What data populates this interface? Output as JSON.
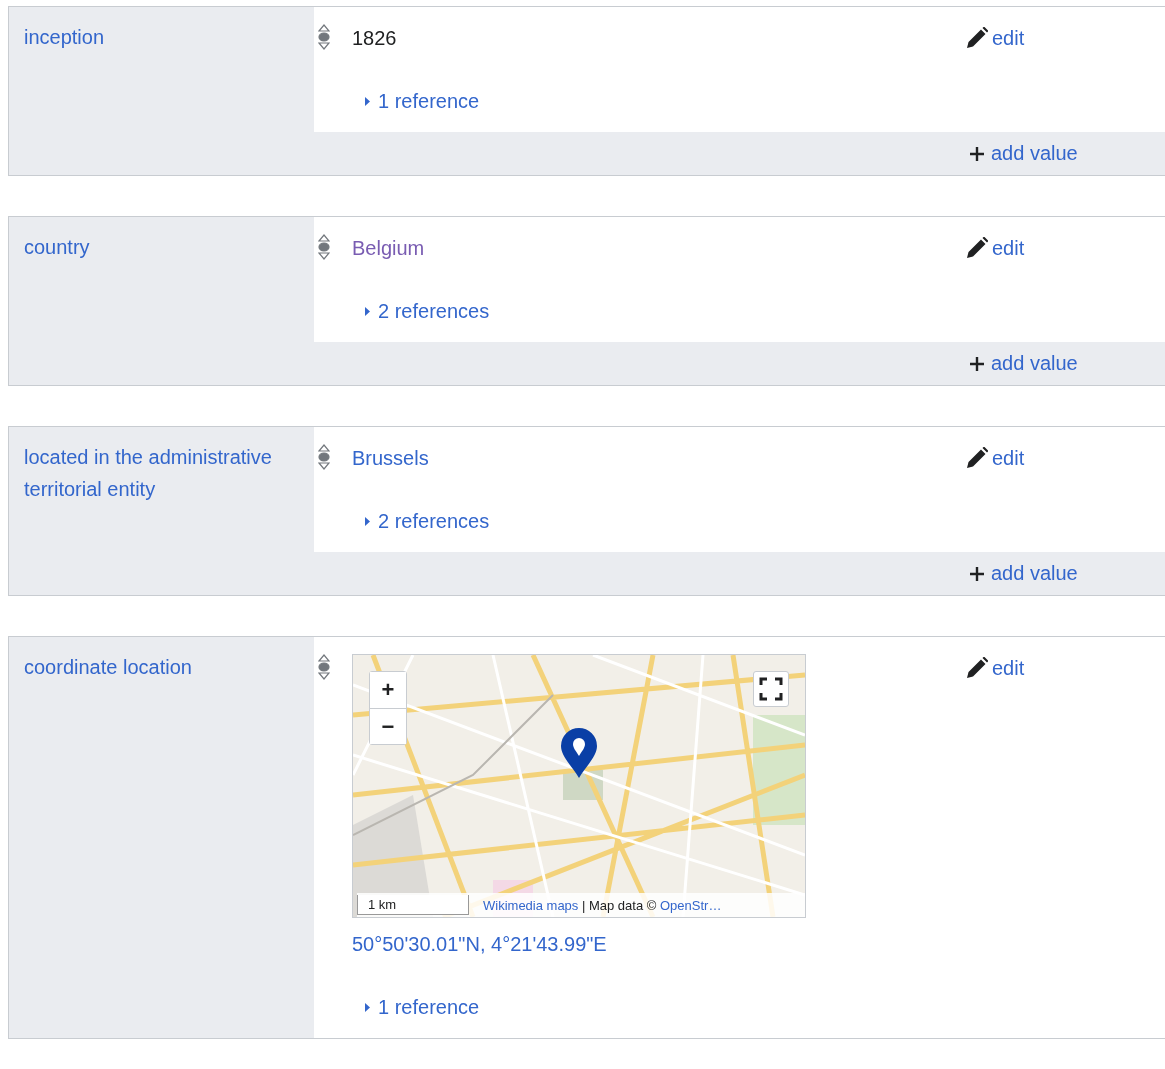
{
  "statements": [
    {
      "property": "inception",
      "values": [
        {
          "kind": "text",
          "preferred": false,
          "deprecated": false,
          "text": "1826",
          "references": {
            "label": "1 reference",
            "expanded": false
          },
          "edit": "edit"
        }
      ],
      "add_value": "add value"
    },
    {
      "property": "country",
      "values": [
        {
          "kind": "visited",
          "preferred": false,
          "deprecated": false,
          "text": "Belgium",
          "references": {
            "label": "2 references",
            "expanded": false
          },
          "edit": "edit"
        }
      ],
      "add_value": "add value"
    },
    {
      "property": "located in the administrative territorial entity",
      "values": [
        {
          "kind": "link",
          "preferred": false,
          "deprecated": false,
          "text": "Brussels",
          "references": {
            "label": "2 references",
            "expanded": false
          },
          "edit": "edit"
        }
      ],
      "add_value": "add value"
    },
    {
      "property": "coordinate location",
      "values": [
        {
          "kind": "map",
          "preferred": false,
          "deprecated": false,
          "map": {
            "zoom_in": "+",
            "zoom_out": "−",
            "scale": "1 km",
            "attribution_link": "Wikimedia maps",
            "attribution_text": "| Map data ©",
            "attribution_source": "OpenStr…"
          },
          "text": "50°50'30.01\"N, 4°21'43.99\"E",
          "references": {
            "label": "1 reference",
            "expanded": false
          },
          "edit": "edit"
        }
      ]
    }
  ]
}
